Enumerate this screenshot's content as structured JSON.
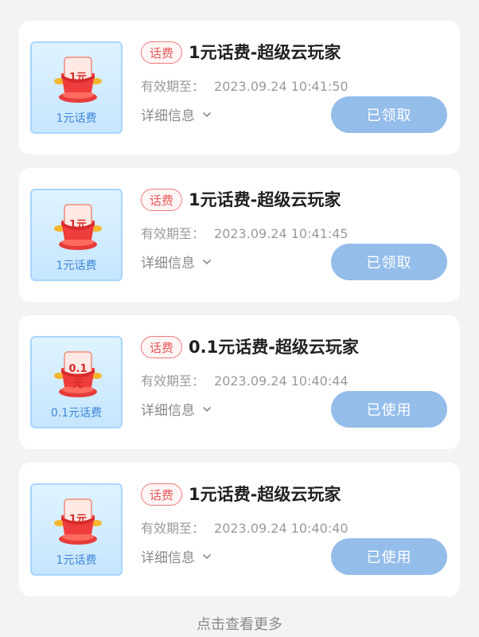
{
  "cards": [
    {
      "thumb_label": "1元话费",
      "thumb_amount": "1元",
      "tag": "话费",
      "title": "1元话费-超级云玩家",
      "expire_label": "有效期至：",
      "expire_time": "2023.09.24 10:41:50",
      "details_label": "详细信息",
      "button_label": "已领取"
    },
    {
      "thumb_label": "1元话费",
      "thumb_amount": "1元",
      "tag": "话费",
      "title": "1元话费-超级云玩家",
      "expire_label": "有效期至：",
      "expire_time": "2023.09.24 10:41:45",
      "details_label": "详细信息",
      "button_label": "已领取"
    },
    {
      "thumb_label": "0.1元话费",
      "thumb_amount": "0.1元",
      "tag": "话费",
      "title": "0.1元话费-超级云玩家",
      "expire_label": "有效期至：",
      "expire_time": "2023.09.24 10:40:44",
      "details_label": "详细信息",
      "button_label": "已使用"
    },
    {
      "thumb_label": "1元话费",
      "thumb_amount": "1元",
      "tag": "话费",
      "title": "1元话费-超级云玩家",
      "expire_label": "有效期至：",
      "expire_time": "2023.09.24 10:40:40",
      "details_label": "详细信息",
      "button_label": "已使用"
    }
  ],
  "footer": {
    "more_label": "点击查看更多"
  },
  "colors": {
    "button_bg": "#94bdea",
    "tag_border": "#f07a7a",
    "thumb_bg": "#c6e6ff"
  }
}
